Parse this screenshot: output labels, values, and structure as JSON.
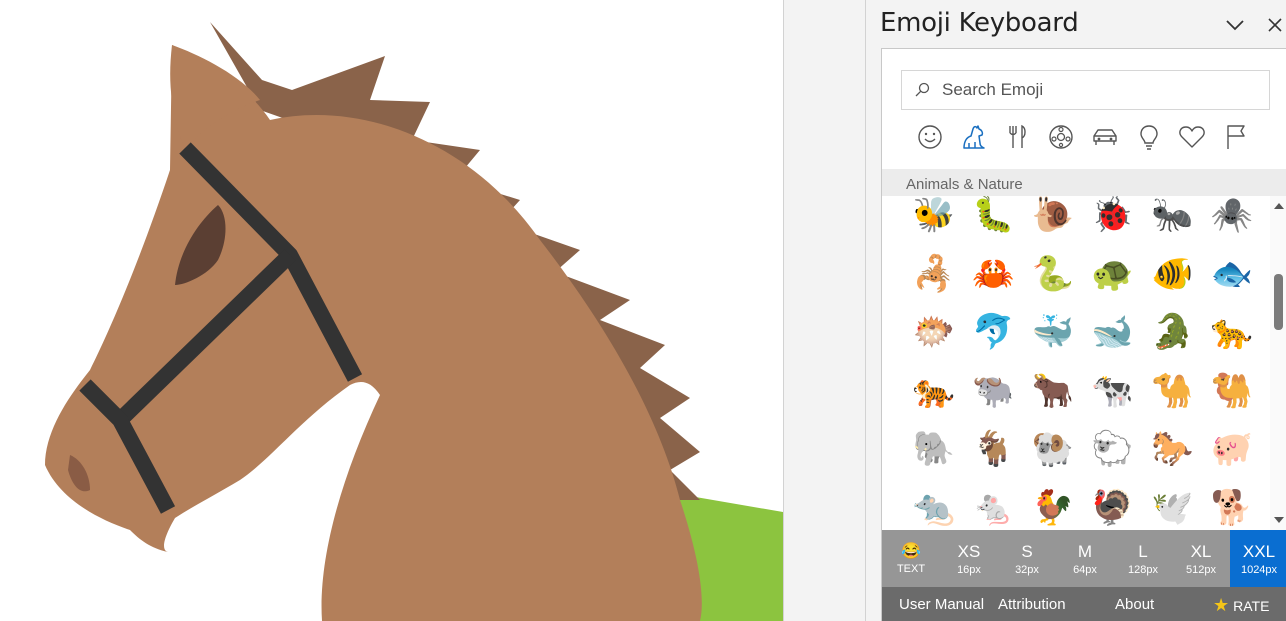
{
  "pane": {
    "title": "Emoji Keyboard"
  },
  "search": {
    "placeholder": "Search Emoji"
  },
  "categories": [
    {
      "name": "smileys",
      "icon": "smiley-icon"
    },
    {
      "name": "animals",
      "icon": "animal-icon",
      "active": true
    },
    {
      "name": "food",
      "icon": "cutlery-icon"
    },
    {
      "name": "activities",
      "icon": "ball-icon"
    },
    {
      "name": "travel",
      "icon": "car-icon"
    },
    {
      "name": "objects",
      "icon": "lightbulb-icon"
    },
    {
      "name": "symbols",
      "icon": "heart-icon"
    },
    {
      "name": "flags",
      "icon": "flag-icon"
    }
  ],
  "section": {
    "label": "Animals & Nature"
  },
  "emoji_rows": [
    [
      "🐝",
      "🐛",
      "🐌",
      "🐞",
      "🐜",
      "🕷️"
    ],
    [
      "🦂",
      "🦀",
      "🐍",
      "🐢",
      "🐠",
      "🐟"
    ],
    [
      "🐡",
      "🐬",
      "🐳",
      "🐋",
      "🐊",
      "🐆"
    ],
    [
      "🐅",
      "🐃",
      "🐂",
      "🐄",
      "🐪",
      "🐫"
    ],
    [
      "🐘",
      "🐐",
      "🐏",
      "🐑",
      "🐎",
      "🐖"
    ],
    [
      "🐀",
      "🐁",
      "🐓",
      "🦃",
      "🕊️",
      "🐕"
    ]
  ],
  "sizes": [
    {
      "label": "TEXT",
      "px": "",
      "icon": "laughing-emoji-icon",
      "active": false
    },
    {
      "label": "XS",
      "px": "16px",
      "active": false
    },
    {
      "label": "S",
      "px": "32px",
      "active": false
    },
    {
      "label": "M",
      "px": "64px",
      "active": false
    },
    {
      "label": "L",
      "px": "128px",
      "active": false
    },
    {
      "label": "XL",
      "px": "512px",
      "active": false
    },
    {
      "label": "XXL",
      "px": "1024px",
      "active": true
    }
  ],
  "footer": {
    "manual": "User Manual",
    "attribution": "Attribution",
    "about": "About",
    "rate": "RATE"
  },
  "colors": {
    "accent": "#0a6ed1",
    "size_bar": "#969696",
    "footer": "#6b6b6b",
    "icon": "#555555",
    "icon_active": "#1a6fc0"
  }
}
